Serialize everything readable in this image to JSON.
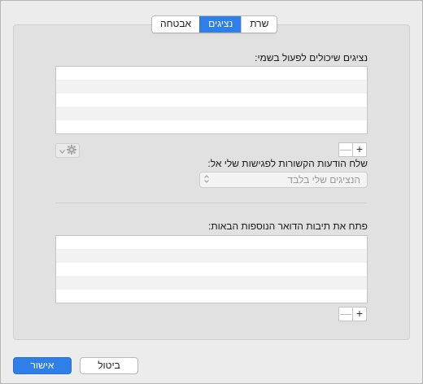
{
  "tabs": [
    {
      "label": "שרת",
      "active": false
    },
    {
      "label": "נציגים",
      "active": true
    },
    {
      "label": "אבטחה",
      "active": false
    }
  ],
  "delegates_section": {
    "label": "נציגים שיכולים לפעול בשמי:",
    "list_rows": 5
  },
  "list_controls": {
    "add": "+",
    "remove": "—"
  },
  "send_messages": {
    "label": "שלח הודעות הקשורות לפגישות שלי אל:",
    "select_value": "הנציגים שלי בלבד"
  },
  "mailboxes_section": {
    "label": "פתח את תיבות הדואר הנוספות הבאות:",
    "list_rows": 5
  },
  "footer": {
    "ok_label": "אישור",
    "cancel_label": "ביטול"
  },
  "colors": {
    "accent": "#2f7fe8",
    "background": "#ececec",
    "panel": "#e1e1e1"
  },
  "icons": {
    "gear": "gear-icon",
    "dropdown": "chevron-down-icon",
    "select_arrows": "updown-arrows-icon"
  }
}
